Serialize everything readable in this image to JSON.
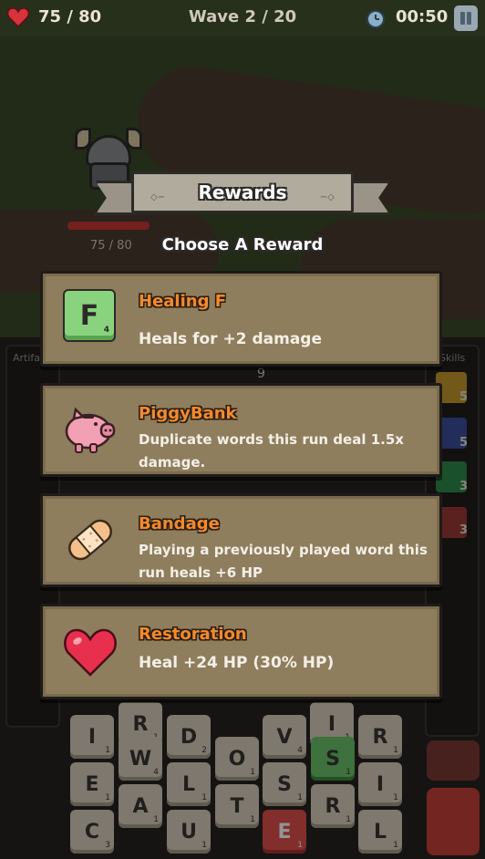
{
  "topbar": {
    "hp": "75 / 80",
    "wave": "Wave 2 / 20",
    "timer": "00:50"
  },
  "hero": {
    "hp_text": "75 / 80"
  },
  "modal": {
    "title": "Rewards",
    "subtitle": "Choose A Reward",
    "rewards": [
      {
        "name": "Healing F",
        "description": "Heals for +2 damage",
        "icon": "letter-tile-icon",
        "tile_letter": "F",
        "tile_value": "4"
      },
      {
        "name": "PiggyBank",
        "description": "Duplicate words this run deal 1.5x damage.",
        "icon": "piggy-bank-icon"
      },
      {
        "name": "Bandage",
        "description": "Playing a previously played word this run heals +6 HP",
        "icon": "bandage-icon"
      },
      {
        "name": "Restoration",
        "description": "Heal +24 HP (30% HP)",
        "icon": "heart-icon"
      }
    ]
  },
  "background": {
    "artifacts_label": "Artifa",
    "skills_label": "Skills",
    "damage_preview": "9",
    "skills": [
      {
        "icon": "refresh-icon",
        "count": "5",
        "color": "#c59a2e"
      },
      {
        "icon": "shuffle-icon",
        "count": "5",
        "color": "#3b4f9a"
      },
      {
        "icon": "swap-icon",
        "count": "3",
        "color": "#2e8a4a"
      },
      {
        "icon": "hammer-icon",
        "count": "3",
        "color": "#9b3a36"
      }
    ],
    "tiles": [
      {
        "letter": "R",
        "value": "1"
      },
      {
        "letter": "I",
        "value": "1"
      },
      {
        "letter": "I",
        "value": "1"
      },
      {
        "letter": "D",
        "value": "2"
      },
      {
        "letter": "V",
        "value": "4"
      },
      {
        "letter": "R",
        "value": "1"
      },
      {
        "letter": "W",
        "value": "4"
      },
      {
        "letter": "O",
        "value": "1"
      },
      {
        "letter": "S",
        "value": "1"
      },
      {
        "letter": "E",
        "value": "1"
      },
      {
        "letter": "L",
        "value": "1"
      },
      {
        "letter": "S",
        "value": "1"
      },
      {
        "letter": "I",
        "value": "1"
      },
      {
        "letter": "A",
        "value": "1"
      },
      {
        "letter": "T",
        "value": "1"
      },
      {
        "letter": "R",
        "value": "1"
      },
      {
        "letter": "C",
        "value": "3"
      },
      {
        "letter": "U",
        "value": "1"
      },
      {
        "letter": "E",
        "value": "1"
      },
      {
        "letter": "L",
        "value": "1"
      }
    ]
  },
  "colors": {
    "card_bg": "#8e7e5e",
    "reward_name": "#f28a2e",
    "heart": "#e8304e",
    "piggy": "#f2a0b4",
    "bandage": "#f4c08a"
  }
}
